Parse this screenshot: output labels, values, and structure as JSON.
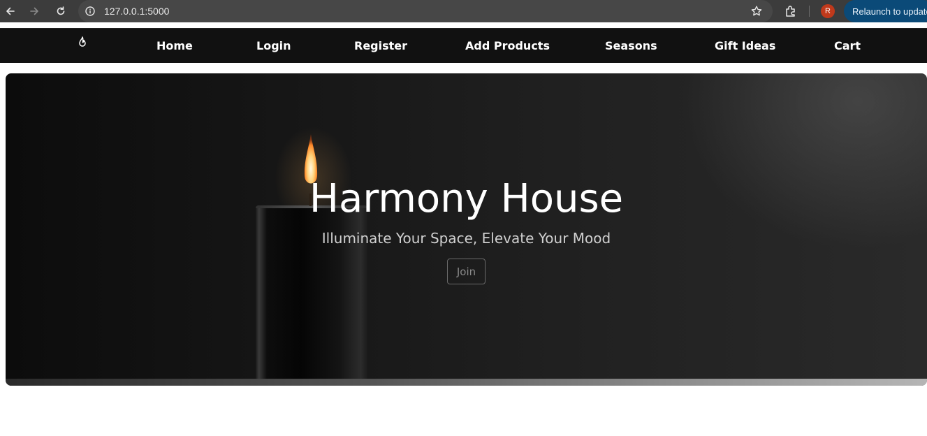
{
  "browser": {
    "url": "127.0.0.1:5000",
    "avatar_letter": "R",
    "relaunch_label": "Relaunch to update",
    "icons": [
      "back-icon",
      "forward-icon",
      "reload-icon",
      "site-info-icon",
      "bookmark-star-icon",
      "extensions-icon"
    ]
  },
  "navbar": {
    "logo_icon": "flame-icon",
    "links": [
      {
        "label": "Home"
      },
      {
        "label": "Login"
      },
      {
        "label": "Register"
      },
      {
        "label": "Add Products"
      },
      {
        "label": "Seasons"
      },
      {
        "label": "Gift Ideas"
      },
      {
        "label": "Cart"
      }
    ]
  },
  "hero": {
    "title": "Harmony House",
    "subtitle": "Illuminate Your Space, Elevate Your Mood",
    "cta_label": "Join",
    "background_image": "candle-image"
  },
  "colors": {
    "navbar_bg": "#111111",
    "chrome_bg": "#3c3c3c",
    "relaunch_bg": "#0b4a78",
    "avatar_bg": "#c0391b"
  }
}
